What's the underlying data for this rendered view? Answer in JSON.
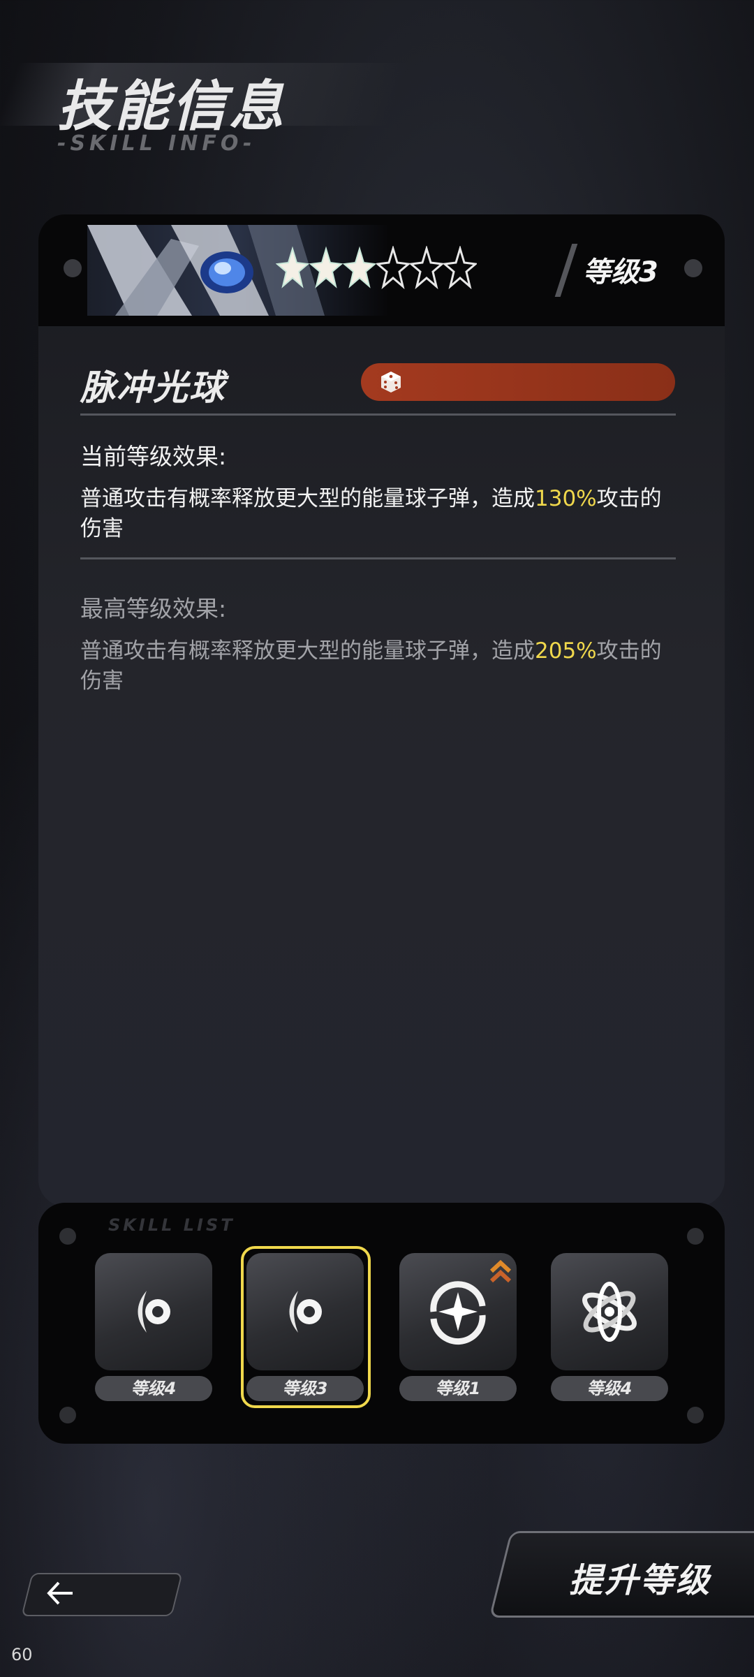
{
  "header": {
    "title": "技能信息",
    "subtitle": "-SKILL INFO-"
  },
  "skill": {
    "name": "脉冲光球",
    "rarity": {
      "filled": 3,
      "total": 6
    },
    "level_label": "等级3",
    "tag_icon": "dice-icon",
    "tag_color": "#a43a1f",
    "current_effect": {
      "title": "当前等级效果:",
      "text_before": "普通攻击有概率释放更大型的能量球子弹，造成",
      "highlight": "130%",
      "text_after": "攻击的伤害"
    },
    "max_effect": {
      "title": "最高等级效果:",
      "text_before": "普通攻击有概率释放更大型的能量球子弹，造成",
      "highlight": "205%",
      "text_after": "攻击的伤害"
    }
  },
  "skill_list": {
    "label": "SKILL LIST",
    "items": [
      {
        "icon": "pulse-orb-icon",
        "level": "等级4",
        "selected": false,
        "upgradable": false
      },
      {
        "icon": "pulse-orb-icon",
        "level": "等级3",
        "selected": true,
        "upgradable": false
      },
      {
        "icon": "star-ring-icon",
        "level": "等级1",
        "selected": false,
        "upgradable": true
      },
      {
        "icon": "atom-icon",
        "level": "等级4",
        "selected": false,
        "upgradable": false
      }
    ]
  },
  "actions": {
    "back_icon": "back-arrow-icon",
    "upgrade_label": "提升等级"
  },
  "status": {
    "fps": "60"
  },
  "colors": {
    "highlight": "#f0d84c",
    "accent_border": "#f0d84c"
  }
}
